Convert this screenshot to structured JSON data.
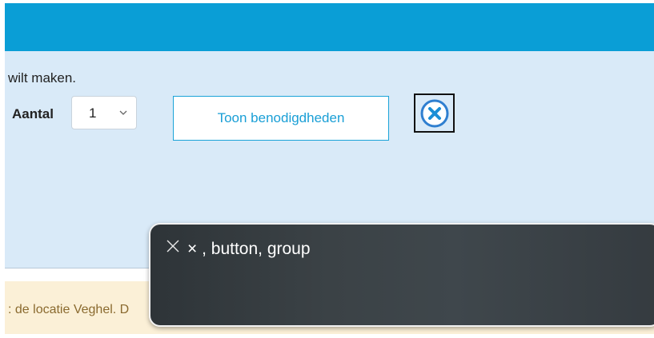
{
  "intro": {
    "text": "wilt maken."
  },
  "quantity": {
    "label": "Aantal",
    "selected": "1"
  },
  "supplies_button": {
    "label": "Toon benodigdheden"
  },
  "close_button": {
    "icon": "close-circle-icon"
  },
  "notice": {
    "text": ": de locatie Veghel. D"
  },
  "voiceover": {
    "caption": "× , button, group"
  },
  "colors": {
    "header_blue": "#0a9ed6",
    "panel_bg": "#d9eaf8",
    "notice_bg": "#fbf0d7",
    "notice_text": "#8a6a2f"
  }
}
